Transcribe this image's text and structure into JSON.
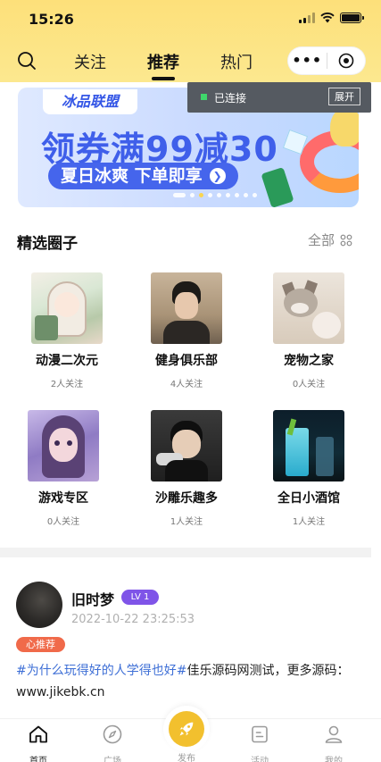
{
  "status_bar": {
    "time": "15:26"
  },
  "nav": {
    "tabs": [
      {
        "label": "关注",
        "active": false
      },
      {
        "label": "推荐",
        "active": true
      },
      {
        "label": "热门",
        "active": false
      }
    ],
    "capsule": {
      "more": "•••"
    }
  },
  "connection": {
    "status": "已连接",
    "expand": "展开"
  },
  "banner": {
    "logo": "冰品联盟",
    "title": "领券满99减30",
    "subtitle": "夏日冰爽 下单即享",
    "dots_count": 9,
    "active_dot": 0
  },
  "circles_section": {
    "title": "精选圈子",
    "all_label": "全部",
    "items": [
      {
        "name": "动漫二次元",
        "fans": "2人关注",
        "icon": "anime-photo"
      },
      {
        "name": "健身俱乐部",
        "fans": "4人关注",
        "icon": "fitness-photo"
      },
      {
        "name": "宠物之家",
        "fans": "0人关注",
        "icon": "pet-photo"
      },
      {
        "name": "游戏专区",
        "fans": "0人关注",
        "icon": "game-photo"
      },
      {
        "name": "沙雕乐趣多",
        "fans": "1人关注",
        "icon": "fun-photo"
      },
      {
        "name": "全日小酒馆",
        "fans": "1人关注",
        "icon": "bar-photo"
      }
    ]
  },
  "post": {
    "username": "旧时梦",
    "level": "LV 1",
    "time": "2022-10-22 23:25:53",
    "badge": "心推荐",
    "hashtag": "#为什么玩得好的人学得也好#",
    "text": "佳乐源码网测试，更多源码：www.jikebk.cn"
  },
  "tabbar": {
    "items": [
      {
        "label": "首页",
        "icon": "home-icon",
        "active": true
      },
      {
        "label": "广场",
        "icon": "compass-icon",
        "active": false
      },
      {
        "label": "发布",
        "icon": "rocket-icon",
        "active": false
      },
      {
        "label": "活动",
        "icon": "activity-icon",
        "active": false
      },
      {
        "label": "我的",
        "icon": "profile-icon",
        "active": false
      }
    ]
  },
  "colors": {
    "header": "#fde07a",
    "accent": "#f2c02e",
    "link": "#3e6fd6",
    "level": "#7f54e8",
    "recommend": "#f06a4a"
  }
}
